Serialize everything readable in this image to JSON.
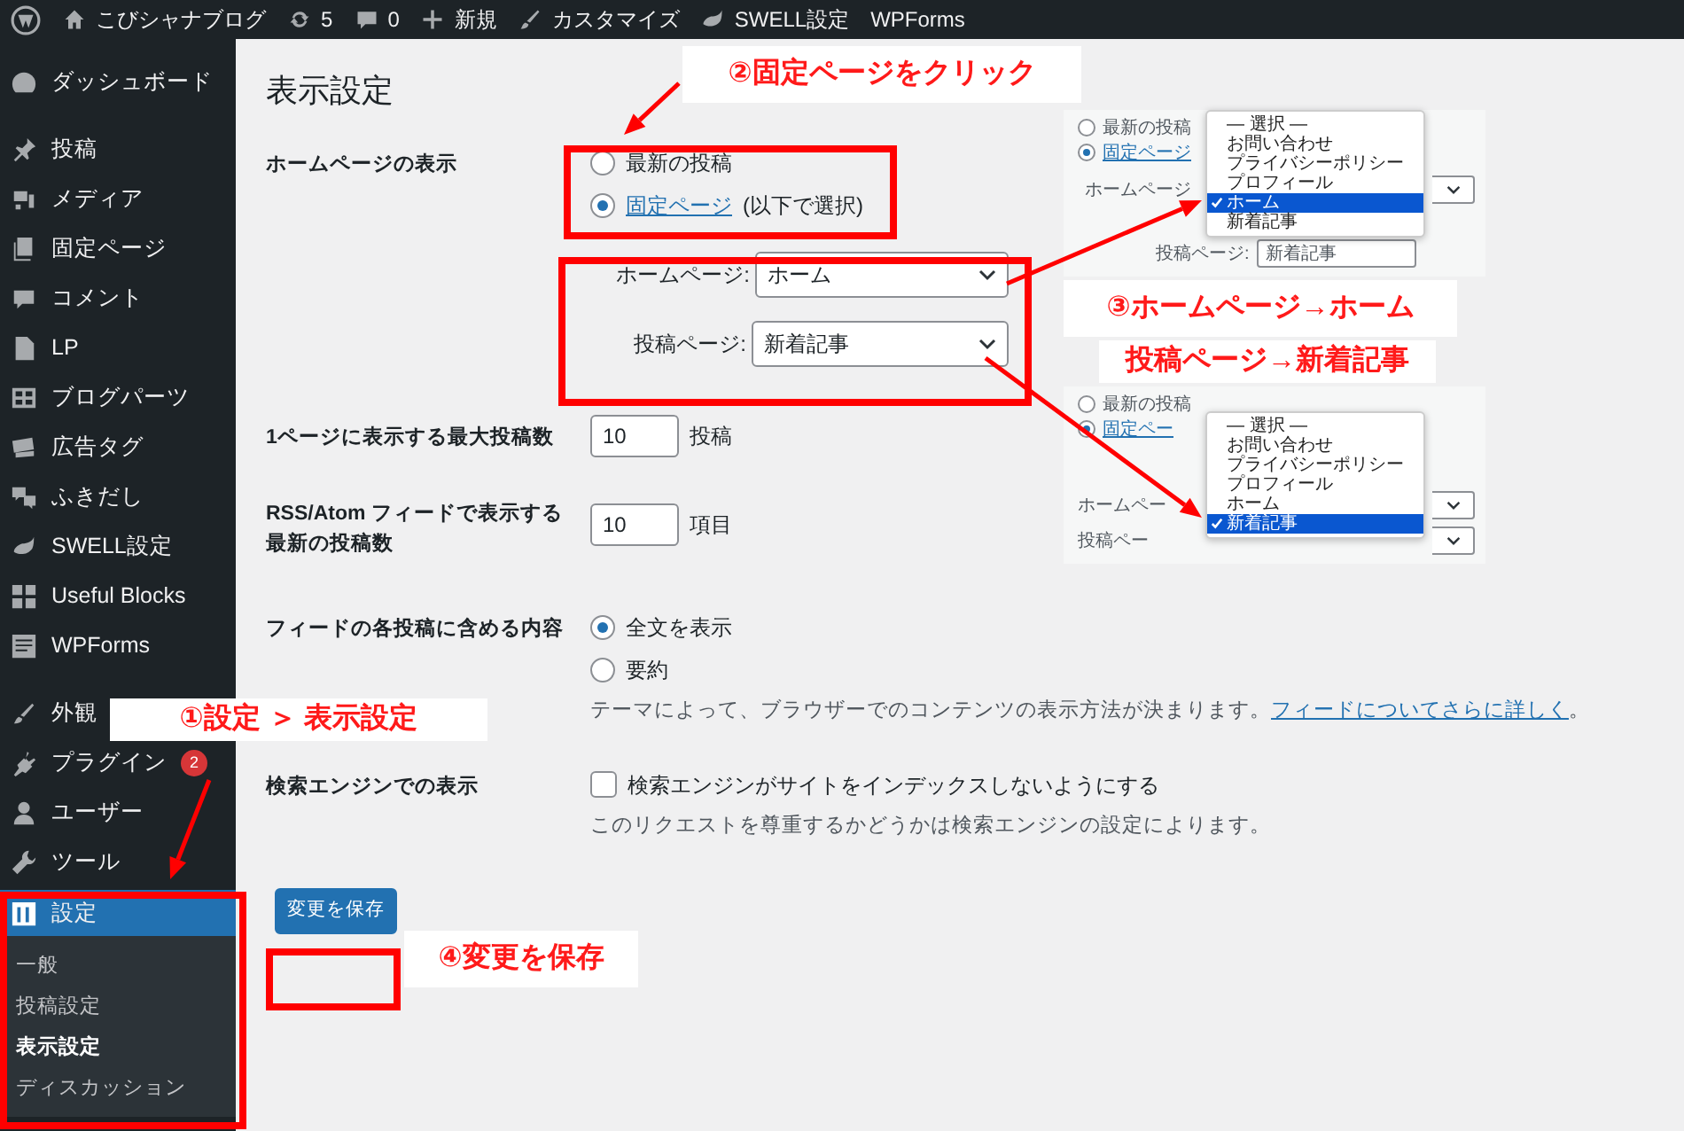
{
  "admin_bar": [
    "こびシャナブログ",
    "5",
    "0",
    "新規",
    "カスタマイズ",
    "SWELL設定",
    "WPForms"
  ],
  "sidebar": {
    "items": [
      {
        "label": "ダッシュボード",
        "selected": false
      },
      {
        "label": "投稿",
        "selected": false
      },
      {
        "label": "メディア",
        "selected": false
      },
      {
        "label": "固定ページ",
        "selected": false
      },
      {
        "label": "コメント",
        "selected": false
      },
      {
        "label": "LP",
        "selected": false
      },
      {
        "label": "ブログパーツ",
        "selected": false
      },
      {
        "label": "広告タグ",
        "selected": false
      },
      {
        "label": "ふきだし",
        "selected": false
      },
      {
        "label": "SWELL設定",
        "selected": false
      },
      {
        "label": "Useful Blocks",
        "selected": false
      },
      {
        "label": "WPForms",
        "selected": false
      },
      {
        "label": "外観",
        "selected": false
      },
      {
        "label": "プラグイン",
        "selected": false,
        "badge": "2"
      },
      {
        "label": "ユーザー",
        "selected": false
      },
      {
        "label": "ツール",
        "selected": false
      },
      {
        "label": "設定",
        "selected": true
      }
    ],
    "submenu": [
      {
        "label": "一般",
        "selected": false
      },
      {
        "label": "投稿設定",
        "selected": false
      },
      {
        "label": "表示設定",
        "selected": true
      },
      {
        "label": "ディスカッション",
        "selected": false
      }
    ]
  },
  "page_title": "表示設定",
  "homepage_display": {
    "label": "ホームページの表示",
    "options": [
      {
        "label": "最新の投稿",
        "selected": false
      },
      {
        "link": "固定ページ",
        "label": "(以下で選択)",
        "selected": true
      }
    ],
    "selects": [
      {
        "label": "ホームページ:",
        "value": "ホーム"
      },
      {
        "label": "投稿ページ:",
        "value": "新着記事"
      }
    ]
  },
  "posts_per_page": {
    "label": "1ページに表示する最大投稿数",
    "value": "10",
    "unit": "投稿"
  },
  "rss_count": {
    "label": "RSS/Atom フィードで表示する最新の投稿数",
    "value": "10",
    "unit": "項目"
  },
  "feed_content": {
    "label": "フィードの各投稿に含める内容",
    "options": [
      {
        "label": "全文を表示",
        "selected": true
      },
      {
        "label": "要約",
        "selected": false
      }
    ],
    "description": "テーマによって、ブラウザーでのコンテンツの表示方法が決まります。",
    "link": "フィードについてさらに詳しく",
    "description_end": "。"
  },
  "search_engine": {
    "label": "検索エンジンでの表示",
    "checkbox": {
      "label": "検索エンジンがサイトをインデックスしないようにする",
      "checked": false
    },
    "description": "このリクエストを尊重するかどうかは検索エンジンの設定によります。"
  },
  "save_button": "変更を保存",
  "callouts": [
    "②固定ページをクリック",
    "③ホームページ→ホーム",
    "投稿ページ→新着記事",
    "①設定 ＞ 表示設定",
    "④変更を保存"
  ],
  "insets": [
    {
      "radios": [
        {
          "label": "最新の投稿",
          "selected": false
        },
        {
          "label": "固定ページ",
          "selected": true
        }
      ],
      "fields": [
        "ホームページ",
        "投稿ページ:"
      ],
      "field_value": "新着記事",
      "options": [
        {
          "label": "— 選択 —",
          "selected": false
        },
        {
          "label": "お問い合わせ",
          "selected": false
        },
        {
          "label": "プライバシーポリシー",
          "selected": false
        },
        {
          "label": "プロフィール",
          "selected": false
        },
        {
          "label": "ホーム",
          "selected": true
        },
        {
          "label": "新着記事",
          "selected": false
        }
      ]
    },
    {
      "radios": [
        {
          "label": "最新の投稿",
          "selected": false
        },
        {
          "label": "固定ペー",
          "selected": true
        }
      ],
      "fields": [
        "ホームペー",
        "投稿ペー"
      ],
      "options": [
        {
          "label": "— 選択 —",
          "selected": false
        },
        {
          "label": "お問い合わせ",
          "selected": false
        },
        {
          "label": "プライバシーポリシー",
          "selected": false
        },
        {
          "label": "プロフィール",
          "selected": false
        },
        {
          "label": "ホーム",
          "selected": false
        },
        {
          "label": "新着記事",
          "selected": true
        }
      ]
    }
  ]
}
